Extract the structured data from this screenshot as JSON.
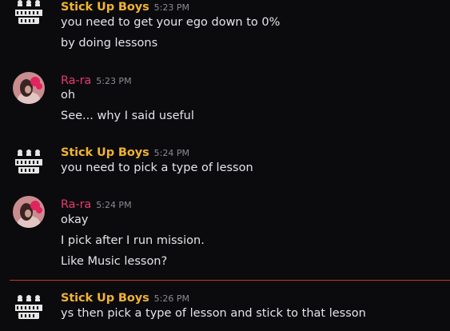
{
  "colors": {
    "background": "#0b0b0e",
    "message_text": "#e3e5e8",
    "timestamp": "#8a8c91",
    "author_stick_up_boys": "#f0b232",
    "author_rara": "#e8396b",
    "new_messages_divider": "#c8332e"
  },
  "avatar_logo_text": "stickup boys",
  "messages": [
    {
      "author": "Stick Up Boys",
      "timestamp": "5:23 PM",
      "lines": [
        "you need to get your ego down to 0%",
        "by doing lessons"
      ]
    },
    {
      "author": "Ra-ra",
      "timestamp": "5:23 PM",
      "lines": [
        "oh",
        "See... why I said useful"
      ]
    },
    {
      "author": "Stick Up Boys",
      "timestamp": "5:24 PM",
      "lines": [
        "you need to pick a type of lesson"
      ]
    },
    {
      "author": "Ra-ra",
      "timestamp": "5:24 PM",
      "lines": [
        "okay",
        "I pick after I run mission.",
        "Like Music lesson?"
      ]
    },
    {
      "author": "Stick Up Boys",
      "timestamp": "5:26 PM",
      "lines": [
        "ys then pick a type of lesson and stick to that lesson"
      ]
    }
  ]
}
